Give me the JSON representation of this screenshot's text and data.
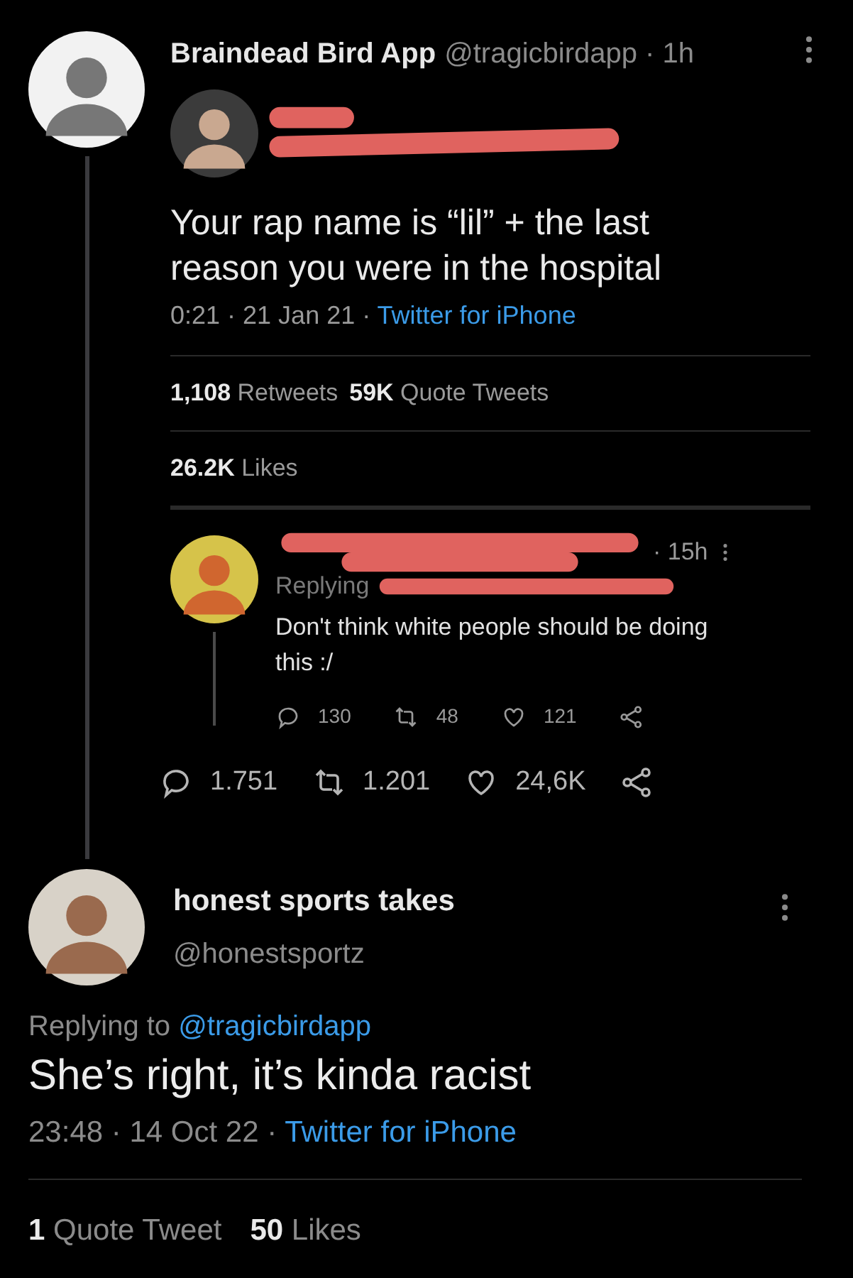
{
  "quote_tweet": {
    "author": "Braindead Bird App",
    "handle_time": "@tragicbirdapp · 1h",
    "screenshot": {
      "text": "Your rap name is “lil” + the last reason you were in the hospital",
      "timestamp": "0:21 · 21 Jan 21 ·",
      "source": "Twitter for iPhone",
      "stats": [
        {
          "count": "1,108",
          "label": "Retweets"
        },
        {
          "count": "59K",
          "label": "Quote Tweets"
        }
      ],
      "likes": {
        "count": "26.2K",
        "label": "Likes"
      },
      "reply": {
        "time": "· 15h",
        "replying": "Replying",
        "text": "Don't think white people should be doing this :/",
        "actions": [
          {
            "kind": "reply",
            "count": "130"
          },
          {
            "kind": "retweet",
            "count": "48"
          },
          {
            "kind": "like",
            "count": "121"
          },
          {
            "kind": "share"
          }
        ]
      }
    },
    "actions": [
      {
        "kind": "reply",
        "count": "1.751"
      },
      {
        "kind": "retweet",
        "count": "1.201"
      },
      {
        "kind": "like",
        "count": "24,6K"
      },
      {
        "kind": "share"
      }
    ]
  },
  "tweet": {
    "author": "honest sports takes",
    "handle": "@honestsportz",
    "replying_prefix": "Replying to",
    "replying_handle": "@tragicbirdapp",
    "text": "She’s right, it’s kinda racist",
    "timestamp": "23:48 · 14 Oct 22 ·",
    "source": "Twitter for iPhone",
    "stats": [
      {
        "count": "1",
        "label": "Quote Tweet"
      },
      {
        "count": "50",
        "label": "Likes"
      }
    ]
  }
}
